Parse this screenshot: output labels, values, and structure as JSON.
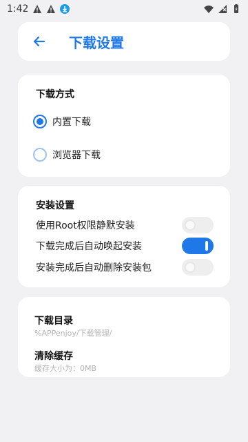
{
  "status_bar": {
    "time": "1:42"
  },
  "header": {
    "title": "下载设置"
  },
  "download_method": {
    "title": "下载方式",
    "options": [
      {
        "label": "内置下载",
        "selected": true
      },
      {
        "label": "浏览器下载",
        "selected": false
      }
    ]
  },
  "install_settings": {
    "title": "安装设置",
    "items": [
      {
        "label": "使用Root权限静默安装",
        "enabled": false
      },
      {
        "label": "下载完成后自动唤起安装",
        "enabled": true
      },
      {
        "label": "安装完成后自动删除安装包",
        "enabled": false
      }
    ]
  },
  "storage": {
    "download_dir_title": "下载目录",
    "download_dir_path": "%APPenjoy/下载管理/",
    "clear_cache_title": "清除缓存",
    "cache_size": "缓存大小为：0MB"
  },
  "colors": {
    "accent": "#1e78e8",
    "background": "#f1f1f3",
    "card": "#ffffff"
  }
}
